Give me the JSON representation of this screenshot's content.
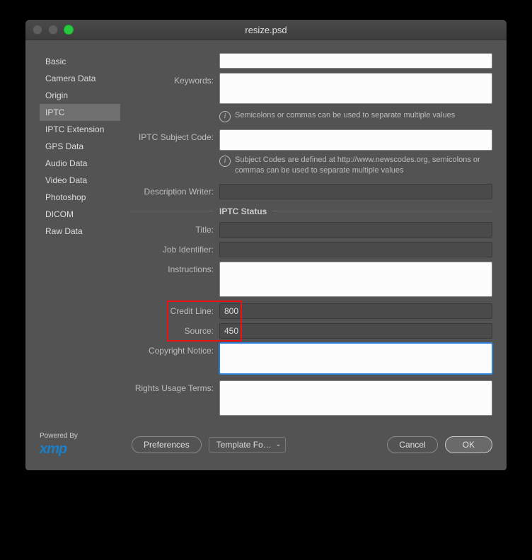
{
  "window_title": "resize.psd",
  "sidebar": {
    "items": [
      {
        "label": "Basic"
      },
      {
        "label": "Camera Data"
      },
      {
        "label": "Origin"
      },
      {
        "label": "IPTC"
      },
      {
        "label": "IPTC Extension"
      },
      {
        "label": "GPS Data"
      },
      {
        "label": "Audio Data"
      },
      {
        "label": "Video Data"
      },
      {
        "label": "Photoshop"
      },
      {
        "label": "DICOM"
      },
      {
        "label": "Raw Data"
      }
    ],
    "selected_index": 3
  },
  "fields": {
    "keywords_label": "Keywords:",
    "keywords_value": "",
    "keywords_hint": "Semicolons or commas can be used to separate multiple values",
    "subject_code_label": "IPTC Subject Code:",
    "subject_code_value": "",
    "subject_code_hint": "Subject Codes are defined at http://www.newscodes.org, semicolons or commas can be used to separate multiple values",
    "desc_writer_label": "Description Writer:",
    "desc_writer_value": "",
    "section_status": "IPTC Status",
    "title_label": "Title:",
    "title_value": "",
    "job_id_label": "Job Identifier:",
    "job_id_value": "",
    "instructions_label": "Instructions:",
    "instructions_value": "",
    "credit_line_label": "Credit Line:",
    "credit_line_value": "800",
    "source_label": "Source:",
    "source_value": "450",
    "copyright_label": "Copyright Notice:",
    "copyright_value": "",
    "rights_label": "Rights Usage Terms:",
    "rights_value": ""
  },
  "footer": {
    "powered_by": "Powered By",
    "logo": "xmp",
    "preferences": "Preferences",
    "template": "Template Fo…",
    "cancel": "Cancel",
    "ok": "OK"
  }
}
